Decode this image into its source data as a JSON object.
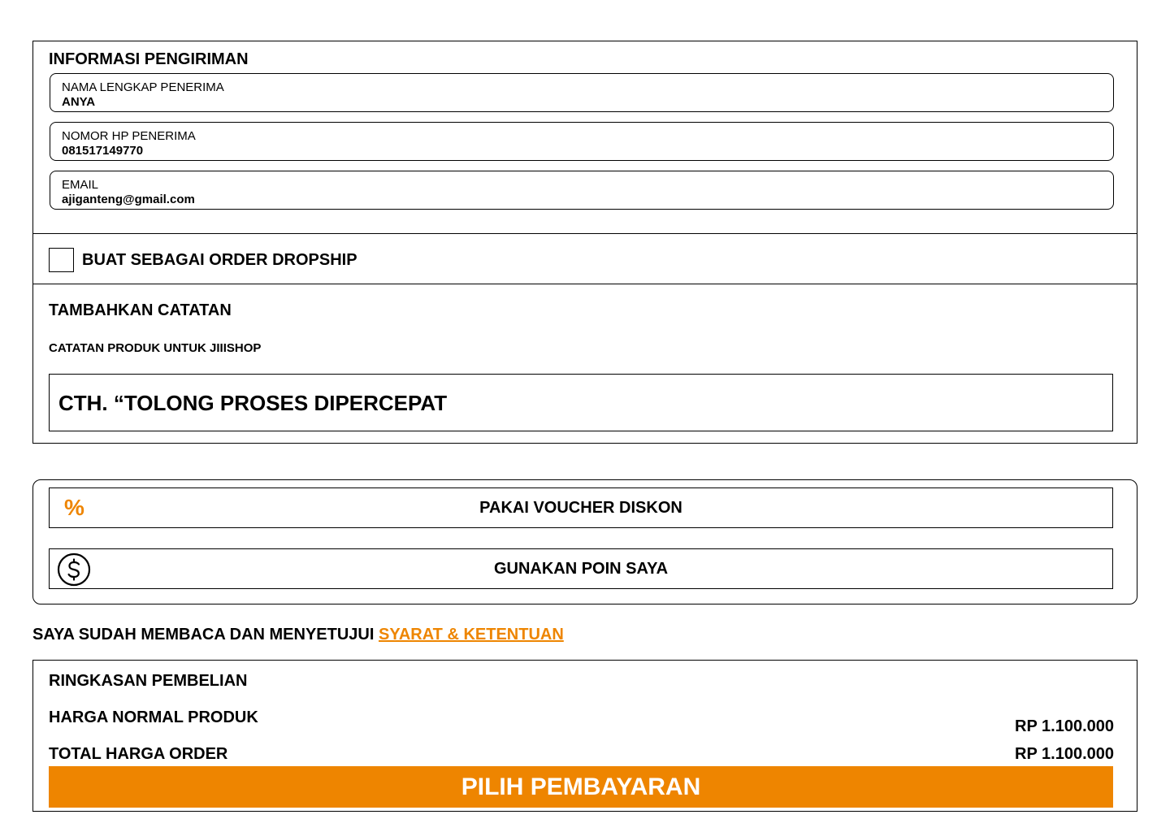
{
  "shipping": {
    "title": "INFORMASI PENGIRIMAN",
    "fields": [
      {
        "label": "NAMA LENGKAP PENERIMA",
        "value": "ANYA"
      },
      {
        "label": "NOMOR HP PENERIMA",
        "value": "081517149770"
      },
      {
        "label": "EMAIL",
        "value": "ajiganteng@gmail.com"
      }
    ],
    "dropship": {
      "label": "BUAT SEBAGAI ORDER DROPSHIP",
      "checked": false
    },
    "notes": {
      "title": "TAMBAHKAN CATATAN",
      "subtitle": "CATATAN PRODUK UNTUK JIIISHOP",
      "placeholder": "CTH. “TOLONG PROSES DIPERCEPAT"
    }
  },
  "promo": {
    "voucher": {
      "icon": "percent-icon",
      "label": "PAKAI VOUCHER DISKON"
    },
    "points": {
      "icon": "dollar-coin-icon",
      "label": "GUNAKAN POIN SAYA"
    }
  },
  "terms": {
    "text": "SAYA SUDAH MEMBACA DAN MENYETUJUI ",
    "link": "SYARAT & KETENTUAN"
  },
  "summary": {
    "title": "RINGKASAN PEMBELIAN",
    "normal_price_label": "HARGA NORMAL PRODUK",
    "normal_price_value": "RP 1.100.000",
    "total_label": "TOTAL HARGA ORDER",
    "total_value": "RP 1.100.000",
    "pay_button": "PILIH PEMBAYARAN"
  },
  "colors": {
    "accent": "#ee8500",
    "border": "#000000",
    "background": "#ffffff"
  }
}
